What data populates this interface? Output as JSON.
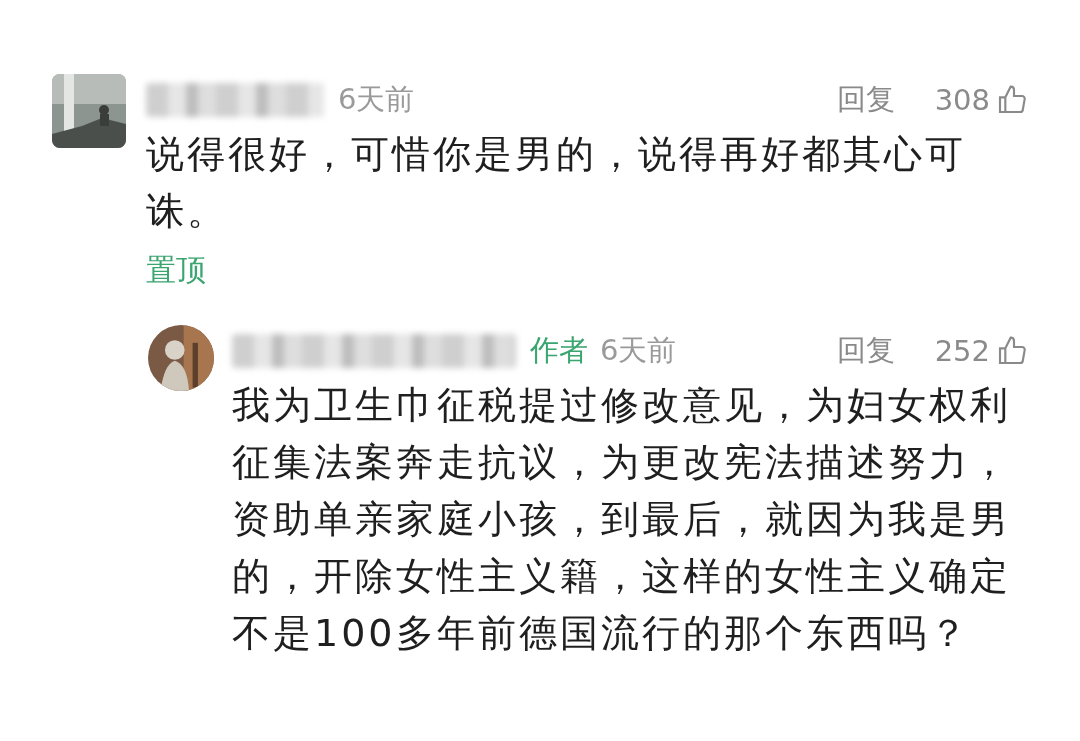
{
  "comments": [
    {
      "time": "6天前",
      "reply": "回复",
      "likes": "308",
      "body": "说得很好，可惜你是男的，说得再好都其心可诛。",
      "pinned_label": "置顶",
      "replies": [
        {
          "author_badge": "作者",
          "time": "6天前",
          "reply": "回复",
          "likes": "252",
          "body": "我为卫生巾征税提过修改意见，为妇女权利征集法案奔走抗议，为更改宪法描述努力，资助单亲家庭小孩，到最后，就因为我是男的，开除女性主义籍，这样的女性主义确定不是100多年前德国流行的那个东西吗？"
        }
      ]
    }
  ]
}
